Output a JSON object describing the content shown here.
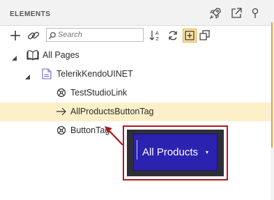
{
  "header": {
    "title": "ELEMENTS",
    "icons": [
      "rocket-icon",
      "external-link-icon",
      "pin-icon"
    ]
  },
  "toolbar": {
    "search_placeholder": "Search",
    "icons": [
      "add-icon",
      "link-icon",
      "sort-az-icon",
      "refresh-icon",
      "add-element-icon",
      "copy-icon"
    ]
  },
  "tree": {
    "items": [
      {
        "label": "All Pages",
        "icon": "book-icon",
        "level": 0,
        "expanded": true
      },
      {
        "label": "TelerikKendoUINET",
        "icon": "page-icon",
        "level": 1,
        "expanded": true
      },
      {
        "label": "TestStudioLink",
        "icon": "crosshair-icon",
        "level": 2
      },
      {
        "label": "AllProductsButtonTag",
        "icon": "arrow-right-icon",
        "level": 2,
        "selected": true
      },
      {
        "label": "ButtonTag",
        "icon": "crosshair-icon",
        "level": 2
      }
    ]
  },
  "callout": {
    "button_label": "All Products",
    "caret": "▾",
    "border_color": "#b3161e",
    "button_color": "#2b22b0"
  },
  "colors": {
    "selection": "#fdf0c9",
    "accent": "#f0a030"
  }
}
